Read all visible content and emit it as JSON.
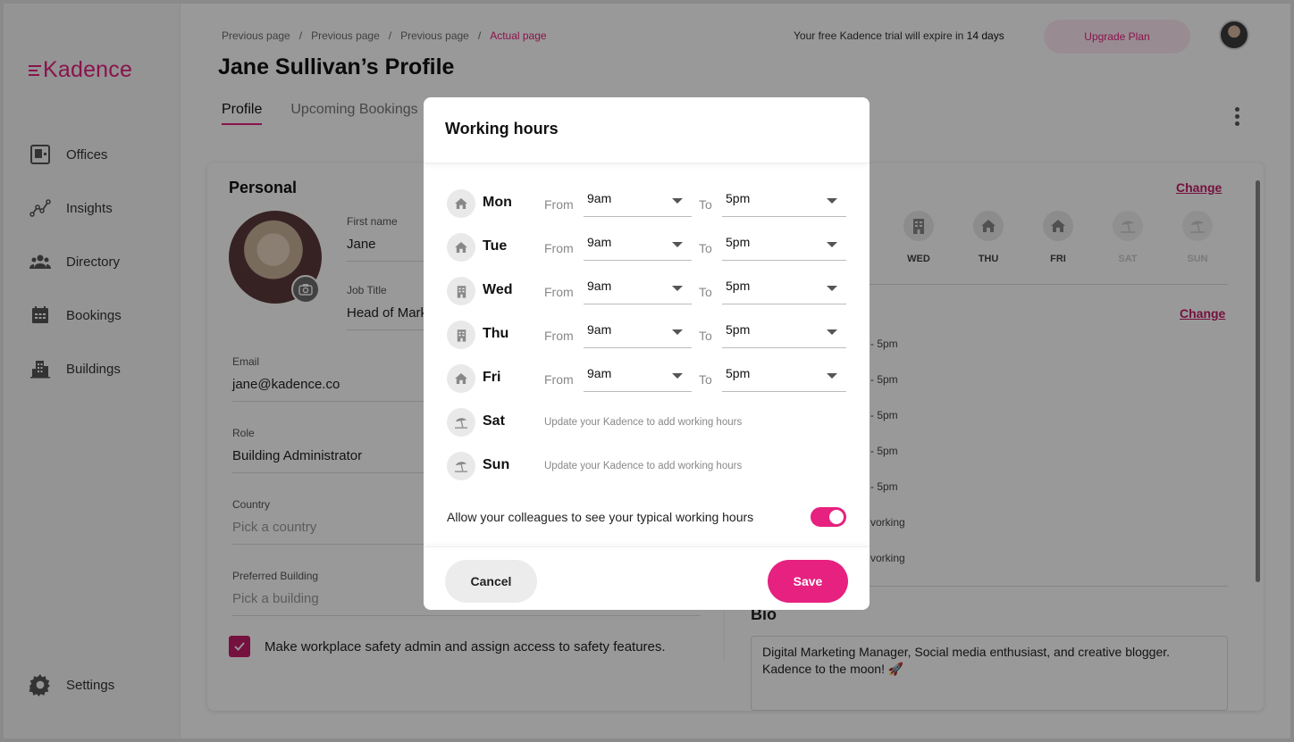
{
  "app": {
    "logo": "Kadence",
    "brand_color": "#e6217f"
  },
  "sidebar": {
    "items": [
      {
        "label": "Offices",
        "icon": "offices-icon"
      },
      {
        "label": "Insights",
        "icon": "insights-icon"
      },
      {
        "label": "Directory",
        "icon": "directory-icon"
      },
      {
        "label": "Bookings",
        "icon": "calendar-icon"
      },
      {
        "label": "Buildings",
        "icon": "buildings-icon"
      }
    ],
    "settings": {
      "label": "Settings",
      "icon": "gear-icon"
    }
  },
  "breadcrumb": [
    "Previous page",
    "/",
    "Previous page",
    "/",
    "Previous page",
    "/",
    "Actual page"
  ],
  "header": {
    "title": "Jane Sullivan’s Profile",
    "trial_prefix": "Your free Kadence trial will expire in ",
    "trial_days": "14 days",
    "upgrade_label": "Upgrade Plan"
  },
  "tabs": [
    {
      "label": "Profile",
      "active": true
    },
    {
      "label": "Upcoming Bookings",
      "active": false
    }
  ],
  "personal": {
    "title": "Personal",
    "first_name_label": "First name",
    "first_name": "Jane",
    "job_title_label": "Job Title",
    "job_title": "Head of Marketing",
    "email_label": "Email",
    "email": "jane@kadence.co",
    "role_label": "Role",
    "role": "Building Administrator",
    "country_label": "Country",
    "country_placeholder": "Pick a country",
    "building_label": "Preferred Building",
    "building_placeholder": "Pick a building",
    "safety_checkbox": "Make workplace safety admin and assign access to safety features.",
    "safety_checked": true
  },
  "right_panel": {
    "change_label": "Change",
    "days": [
      {
        "label": "WED",
        "icon": "building-icon",
        "dim": false
      },
      {
        "label": "THU",
        "icon": "home-icon",
        "dim": false
      },
      {
        "label": "FRI",
        "icon": "home-icon",
        "dim": false
      },
      {
        "label": "SAT",
        "icon": "beach-icon",
        "dim": true
      },
      {
        "label": "SUN",
        "icon": "beach-icon",
        "dim": true
      }
    ],
    "hours_lines": [
      "- 5pm",
      "- 5pm",
      "- 5pm",
      "- 5pm",
      "- 5pm",
      "vorking",
      "vorking"
    ],
    "bio_title": "Bio",
    "bio": "Digital Marketing Manager, Social media enthusiast, and creative blogger. Kadence to the moon! 🚀"
  },
  "modal": {
    "title": "Working hours",
    "from_label": "From",
    "to_label": "To",
    "days": [
      {
        "day": "Mon",
        "icon": "home-icon",
        "from": "9am",
        "to": "5pm"
      },
      {
        "day": "Tue",
        "icon": "home-icon",
        "from": "9am",
        "to": "5pm"
      },
      {
        "day": "Wed",
        "icon": "building-icon",
        "from": "9am",
        "to": "5pm"
      },
      {
        "day": "Thu",
        "icon": "building-icon",
        "from": "9am",
        "to": "5pm"
      },
      {
        "day": "Fri",
        "icon": "home-icon",
        "from": "9am",
        "to": "5pm"
      }
    ],
    "weekend": [
      {
        "day": "Sat",
        "icon": "beach-icon",
        "note": "Update your Kadence to add working hours"
      },
      {
        "day": "Sun",
        "icon": "beach-icon",
        "note": "Update your Kadence to add working hours"
      }
    ],
    "toggle_label": "Allow your colleagues to see your typical working hours",
    "toggle_on": true,
    "cancel_label": "Cancel",
    "save_label": "Save"
  }
}
